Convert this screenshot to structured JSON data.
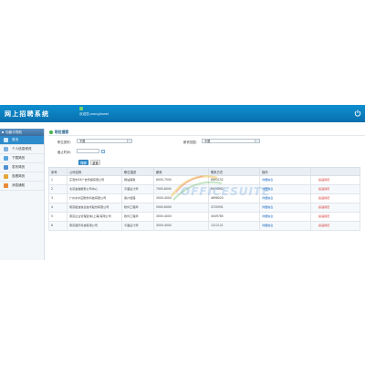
{
  "header": {
    "app_title": "网上招聘系统",
    "welcome_text": "欢迎您,wangjiawei"
  },
  "sidebar": {
    "title": "功能与导航",
    "items": [
      {
        "label": "首页",
        "icon": "home-icon",
        "active": true
      },
      {
        "label": "个人信息修改",
        "icon": "user-icon",
        "active": false
      },
      {
        "label": "下载简历",
        "icon": "download-icon",
        "active": false
      },
      {
        "label": "发布简历",
        "icon": "publish-icon",
        "active": false
      },
      {
        "label": "查看简历",
        "icon": "view-icon",
        "active": false
      },
      {
        "label": "消息通知",
        "icon": "message-icon",
        "active": false
      }
    ]
  },
  "main": {
    "section_title": "职位搜索",
    "form": {
      "position_type_label": "职位类别：",
      "position_type_value": "不限",
      "salary_label": "薪资范围：",
      "salary_value": "不限",
      "deadline_label": "截止时间：",
      "search_button": "搜索",
      "reset_button": "重置"
    },
    "table": {
      "headers": [
        "序号",
        "公司名称",
        "职位描述",
        "薪资",
        "联系方式",
        "操作",
        ""
      ],
      "rows": [
        {
          "no": "1",
          "company": "东莞市XX广告传媒有限公司",
          "desc": "网站编辑",
          "salary": "6000-7000",
          "contact": "6893152",
          "detail": "详细信息",
          "apply": "投递简历"
        },
        {
          "no": "2",
          "company": "北京金融服务公司中心",
          "desc": "平面设计师",
          "salary": "7000-8000",
          "contact": "6974062",
          "detail": "详细信息",
          "apply": "投递简历"
        },
        {
          "no": "3",
          "company": "广州水木园软件科技有限公司",
          "desc": "客户经理",
          "salary": "3000-4000",
          "contact": "4698520",
          "detail": "详细信息",
          "apply": "投递简历"
        },
        {
          "no": "4",
          "company": "南京星波信息技术股份有限公司",
          "desc": "软件工程师",
          "salary": "5000-6000",
          "contact": "3720591",
          "detail": "详细信息",
          "apply": "投递简历"
        },
        {
          "no": "5",
          "company": "南京企业管理咨询(上海)有限公司",
          "desc": "软件工程师",
          "salary": "3000-4000",
          "contact": "4049785",
          "detail": "详细信息",
          "apply": "投递简历"
        },
        {
          "no": "6",
          "company": "南京通讯科技有限公司",
          "desc": "平面设计师",
          "salary": "3000-4000",
          "contact": "1212121",
          "detail": "详细信息",
          "apply": "投递简历"
        }
      ]
    }
  },
  "watermark": {
    "text": "OFFICESUITE"
  },
  "colors": {
    "header": "#0a7ec2",
    "sidebar_active": "#2e8ccc",
    "link": "#1565c0",
    "apply": "#d0312d"
  }
}
